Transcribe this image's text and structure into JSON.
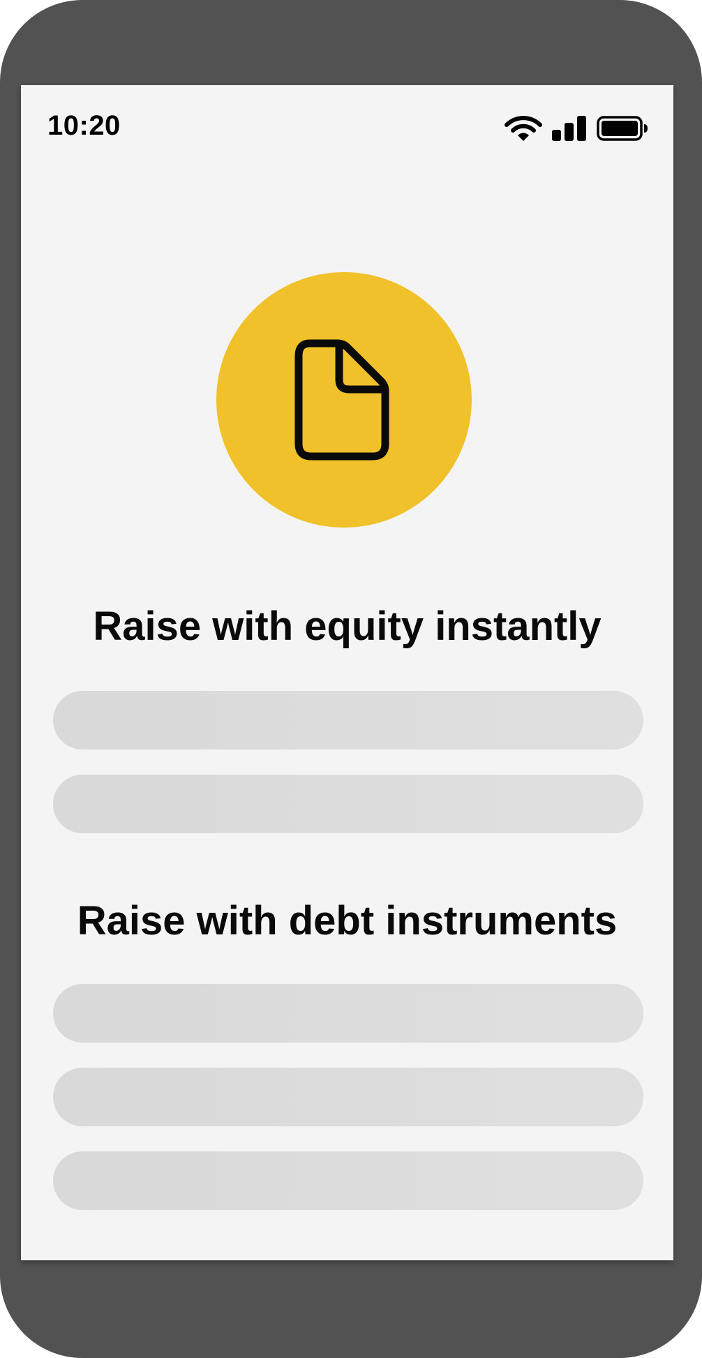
{
  "status_bar": {
    "time": "10:20",
    "icons": [
      "wifi-icon",
      "cellular-signal-icon",
      "battery-icon"
    ]
  },
  "hero": {
    "icon": "document-icon",
    "background_color": "#f0c12a"
  },
  "sections": {
    "equity": {
      "title": "Raise with equity instantly",
      "placeholder_rows": 2
    },
    "debt": {
      "title": "Raise with debt instruments",
      "placeholder_rows": 3
    }
  },
  "colors": {
    "frame": "#525252",
    "screen": "#f4f4f4",
    "accent": "#f0c12a",
    "placeholder": "#dcdcdc",
    "text": "#0a0a0a"
  }
}
